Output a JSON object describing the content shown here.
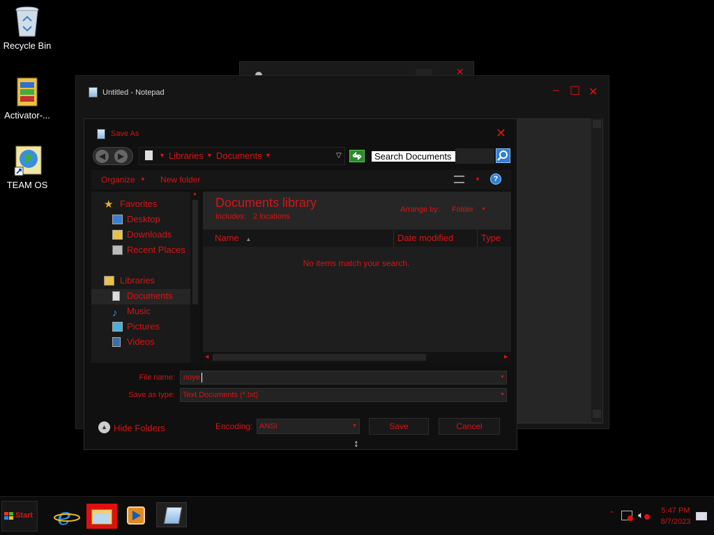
{
  "desktop": {
    "icons": [
      {
        "label": "Recycle Bin",
        "icon": "recycle-bin-icon"
      },
      {
        "label": "Activator-...",
        "icon": "archive-icon"
      },
      {
        "label": "TEAM OS",
        "icon": "globe-shortcut-icon"
      }
    ]
  },
  "notepad": {
    "title": "Untitled - Notepad",
    "controls": {
      "minimize": "–",
      "maximize": "☐",
      "close": "✕"
    }
  },
  "dialog": {
    "title": "Save As",
    "close": "✕",
    "breadcrumb": [
      "Libraries",
      "Documents"
    ],
    "search_placeholder": "Search Documents",
    "toolbar": {
      "organize": "Organize",
      "new_folder": "New folder"
    },
    "nav": {
      "favorites": "Favorites",
      "favorite_items": [
        "Desktop",
        "Downloads",
        "Recent Places"
      ],
      "libraries": "Libraries",
      "library_items": [
        "Documents",
        "Music",
        "Pictures",
        "Videos"
      ]
    },
    "library_header": {
      "title": "Documents library",
      "includes_label": "Includes:",
      "includes_value": "2 locations",
      "arrange_label": "Arrange by:",
      "arrange_value": "Folder"
    },
    "columns": [
      "Name",
      "Date modified",
      "Type"
    ],
    "empty_message": "No items match your search.",
    "file_name_label": "File name:",
    "file_name_value": "noye",
    "save_type_label": "Save as type:",
    "save_type_value": "Text Documents (*.txt)",
    "hide_folders": "Hide Folders",
    "encoding_label": "Encoding:",
    "encoding_value": "ANSI",
    "save_button": "Save",
    "cancel_button": "Cancel"
  },
  "taskbar": {
    "start": "Start",
    "apps": [
      "internet-explorer-icon",
      "file-explorer-icon",
      "media-player-icon",
      "notepad-icon"
    ],
    "time": "5:47 PM",
    "date": "8/7/2023"
  },
  "colors": {
    "accent": "#d81414",
    "background": "#000000",
    "panel": "#141414"
  }
}
